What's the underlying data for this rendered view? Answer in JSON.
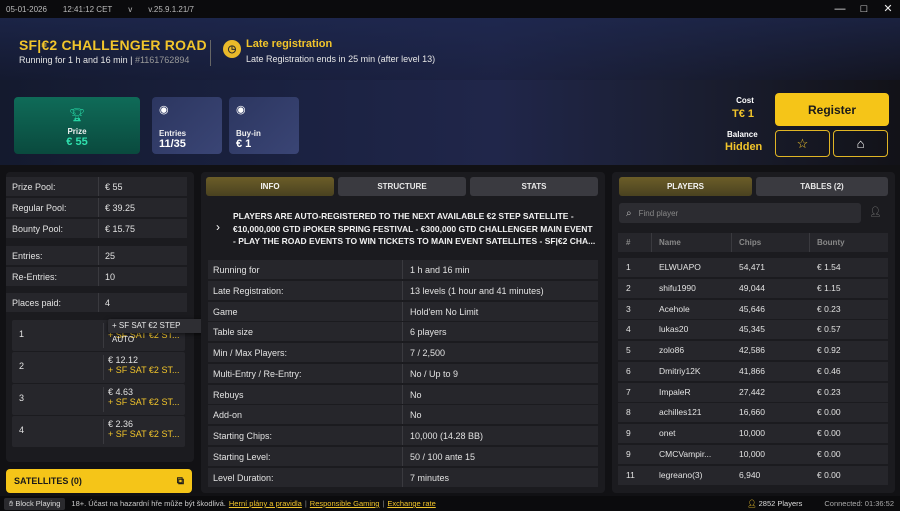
{
  "titlebar": {
    "date": "05-01-2026",
    "time": "12:41:12 CET",
    "version_chevron": "v",
    "version": "v.25.9.1.21/7"
  },
  "tournament": {
    "title": "SF|€2 CHALLENGER ROAD",
    "running": "Running for 1 h and 16 min |",
    "id": "#1161762894"
  },
  "late_reg": {
    "title": "Late registration",
    "subtitle": "Late Registration ends in 25 min (after level 13)"
  },
  "cards": {
    "prize_label": "Prize",
    "prize_value": "€ 55",
    "entries_label": "Entries",
    "entries_value": "11/35",
    "buyin_label": "Buy-in",
    "buyin_value": "€ 1"
  },
  "cost": {
    "label": "Cost",
    "value": "T€ 1",
    "balance_label": "Balance",
    "balance_value": "Hidden"
  },
  "buttons": {
    "register": "Register",
    "satellites": "SATELLITES (0)"
  },
  "left": {
    "rows": [
      {
        "k": "Prize Pool:",
        "v": "€ 55"
      },
      {
        "k": "Regular Pool:",
        "v": "€ 39.25"
      },
      {
        "k": "Bounty Pool:",
        "v": "€ 15.75"
      },
      {
        "k": "Entries:",
        "v": "25"
      },
      {
        "k": "Re-Entries:",
        "v": "10"
      },
      {
        "k": "Places paid:",
        "v": "4"
      }
    ],
    "places": [
      {
        "n": "1",
        "a": "",
        "b": "+ SF SAT €2 ST..."
      },
      {
        "n": "2",
        "a": "€ 12.12",
        "b": "+ SF SAT €2 ST..."
      },
      {
        "n": "3",
        "a": "€ 4.63",
        "b": "+ SF SAT €2 ST..."
      },
      {
        "n": "4",
        "a": "€ 2.36",
        "b": "+ SF SAT €2 ST..."
      }
    ],
    "tooltip": "+ SF SAT €2 STEP AUTO"
  },
  "tabs": {
    "info": "INFO",
    "structure": "STRUCTURE",
    "stats": "STATS",
    "players": "PLAYERS",
    "tables": "TABLES (2)"
  },
  "notice": "PLAYERS ARE AUTO-REGISTERED TO THE NEXT AVAILABLE €2 STEP SATELLITE - €10,000,000 GTD iPOKER SPRING FESTIVAL - €300,000 GTD CHALLENGER MAIN EVENT - PLAY THE ROAD EVENTS TO WIN TICKETS TO MAIN EVENT SATELLITES - SF|€2 CHA...",
  "info": [
    {
      "k": "Running for",
      "v": "1 h and 16 min"
    },
    {
      "k": "Late Registration:",
      "v": "13 levels (1 hour and 41 minutes)"
    },
    {
      "k": "Game",
      "v": "Hold'em No Limit"
    },
    {
      "k": "Table size",
      "v": "6 players"
    },
    {
      "k": "Min / Max Players:",
      "v": "7 / 2,500"
    },
    {
      "k": "Multi-Entry / Re-Entry:",
      "v": "No / Up to 9"
    },
    {
      "k": "Rebuys",
      "v": "No"
    },
    {
      "k": "Add-on",
      "v": "No"
    },
    {
      "k": "Starting Chips:",
      "v": "10,000 (14.28 BB)"
    },
    {
      "k": "Starting Level:",
      "v": "50 / 100 ante 15"
    },
    {
      "k": "Level Duration:",
      "v": "7 minutes"
    }
  ],
  "search": {
    "placeholder": "Find player"
  },
  "players_head": {
    "rank": "#",
    "name": "Name",
    "chips": "Chips",
    "bounty": "Bounty"
  },
  "players": [
    {
      "r": "1",
      "n": "ELWUAPO",
      "c": "54,471",
      "b": "€ 1.54"
    },
    {
      "r": "2",
      "n": "shifu1990",
      "c": "49,044",
      "b": "€ 1.15"
    },
    {
      "r": "3",
      "n": "Acehole",
      "c": "45,646",
      "b": "€ 0.23"
    },
    {
      "r": "4",
      "n": "lukas20",
      "c": "45,345",
      "b": "€ 0.57"
    },
    {
      "r": "5",
      "n": "zolo86",
      "c": "42,586",
      "b": "€ 0.92"
    },
    {
      "r": "6",
      "n": "Dmitriy12K",
      "c": "41,866",
      "b": "€ 0.46"
    },
    {
      "r": "7",
      "n": "ImpaleR",
      "c": "27,442",
      "b": "€ 0.23"
    },
    {
      "r": "8",
      "n": "achilles121",
      "c": "16,660",
      "b": "€ 0.00"
    },
    {
      "r": "9",
      "n": "onet",
      "c": "10,000",
      "b": "€ 0.00"
    },
    {
      "r": "9",
      "n": "CMCVampir...",
      "c": "10,000",
      "b": "€ 0.00"
    },
    {
      "r": "11",
      "n": "legreano(3)",
      "c": "6,940",
      "b": "€ 0.00"
    }
  ],
  "status": {
    "block": "Block Playing",
    "text": "18+. Účast na hazardní hře může být škodlivá.",
    "link1": "Herní plány a pravidla",
    "link2": "Responsible Gaming",
    "link3": "Exchange rate",
    "pipe": "|",
    "players": "2852 Players",
    "connected": "Connected: 01:36:52"
  },
  "colors": {
    "accent": "#f5c518",
    "prize": "#2fe0ad"
  }
}
